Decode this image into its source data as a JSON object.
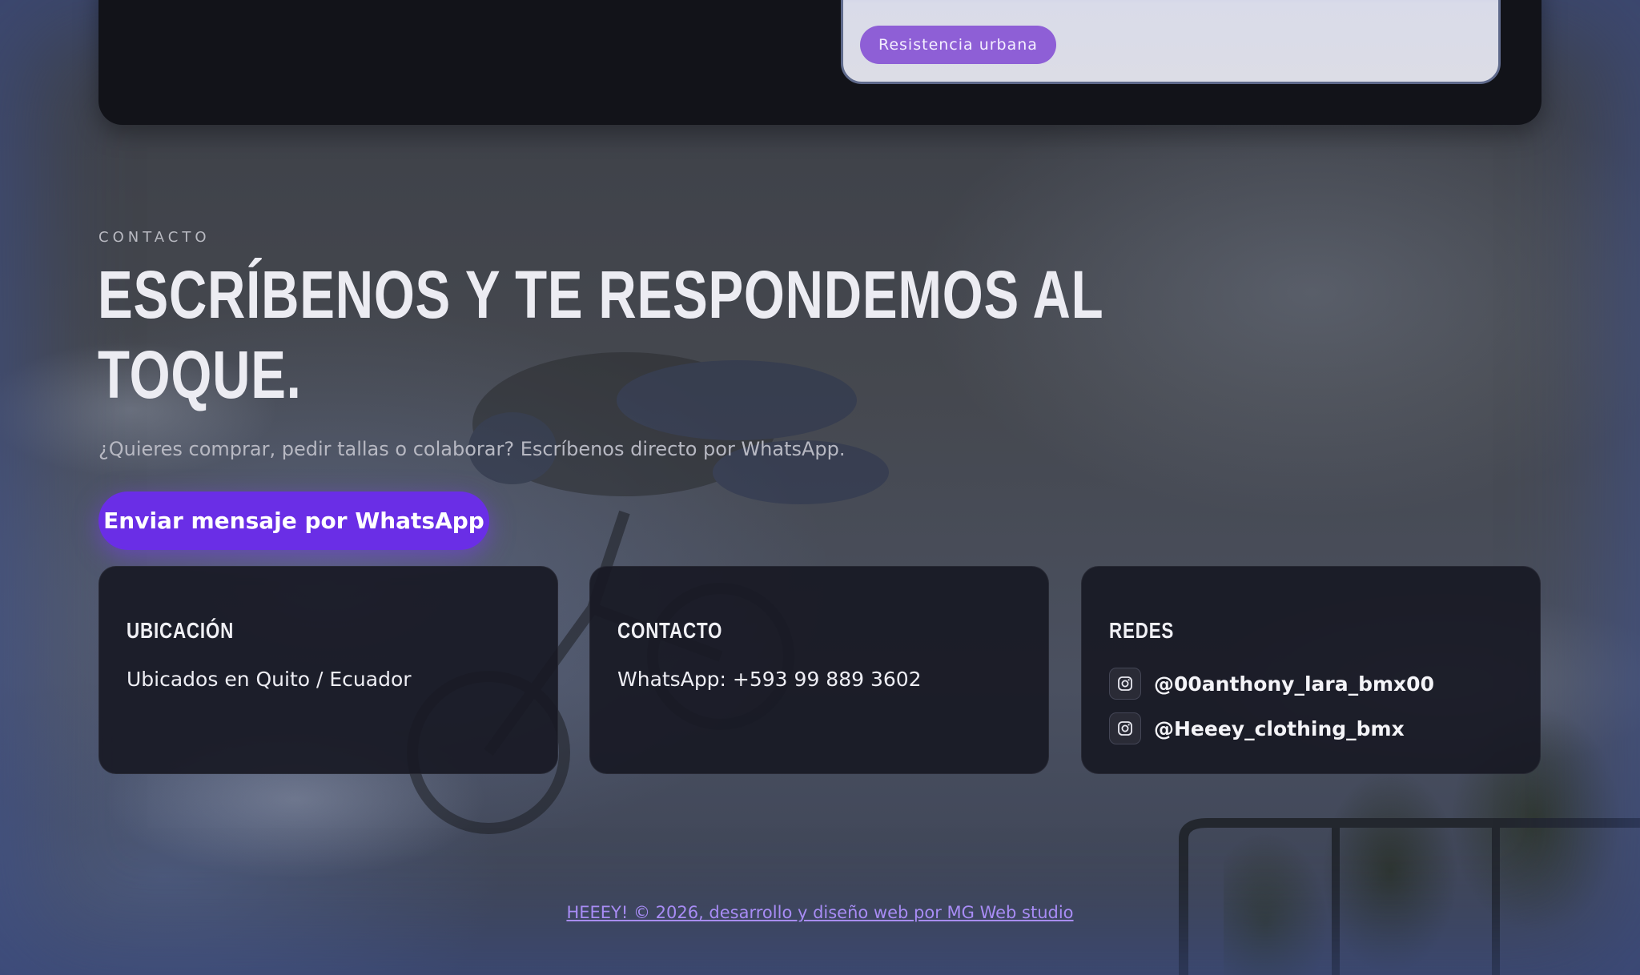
{
  "top_card": {
    "tag_label": "Resistencia urbana"
  },
  "contact": {
    "eyebrow": "CONTACTO",
    "headline_line1": "Escríbenos y te respondemos al",
    "headline_line2": "toque.",
    "subtitle": "¿Quieres comprar, pedir tallas o colaborar? Escríbenos directo por WhatsApp.",
    "cta_label": "Enviar mensaje por WhatsApp"
  },
  "cards": {
    "location": {
      "title": "Ubicación",
      "text": "Ubicados en Quito / Ecuador"
    },
    "contact": {
      "title": "Contacto",
      "text": "WhatsApp: +593 99 889 3602"
    },
    "social": {
      "title": "Redes",
      "items": [
        {
          "icon": "instagram-icon",
          "handle": "@00anthony_lara_bmx00"
        },
        {
          "icon": "instagram-icon",
          "handle": "@Heeey_clothing_bmx"
        }
      ]
    }
  },
  "footer": {
    "credit": "HEEEY! © 2026, desarrollo y diseño web por MG Web studio"
  },
  "colors": {
    "accent": "#6a2ee6",
    "tag": "#8e5fd6",
    "card_bg": "#181924",
    "footer_link": "#a88cf5"
  }
}
